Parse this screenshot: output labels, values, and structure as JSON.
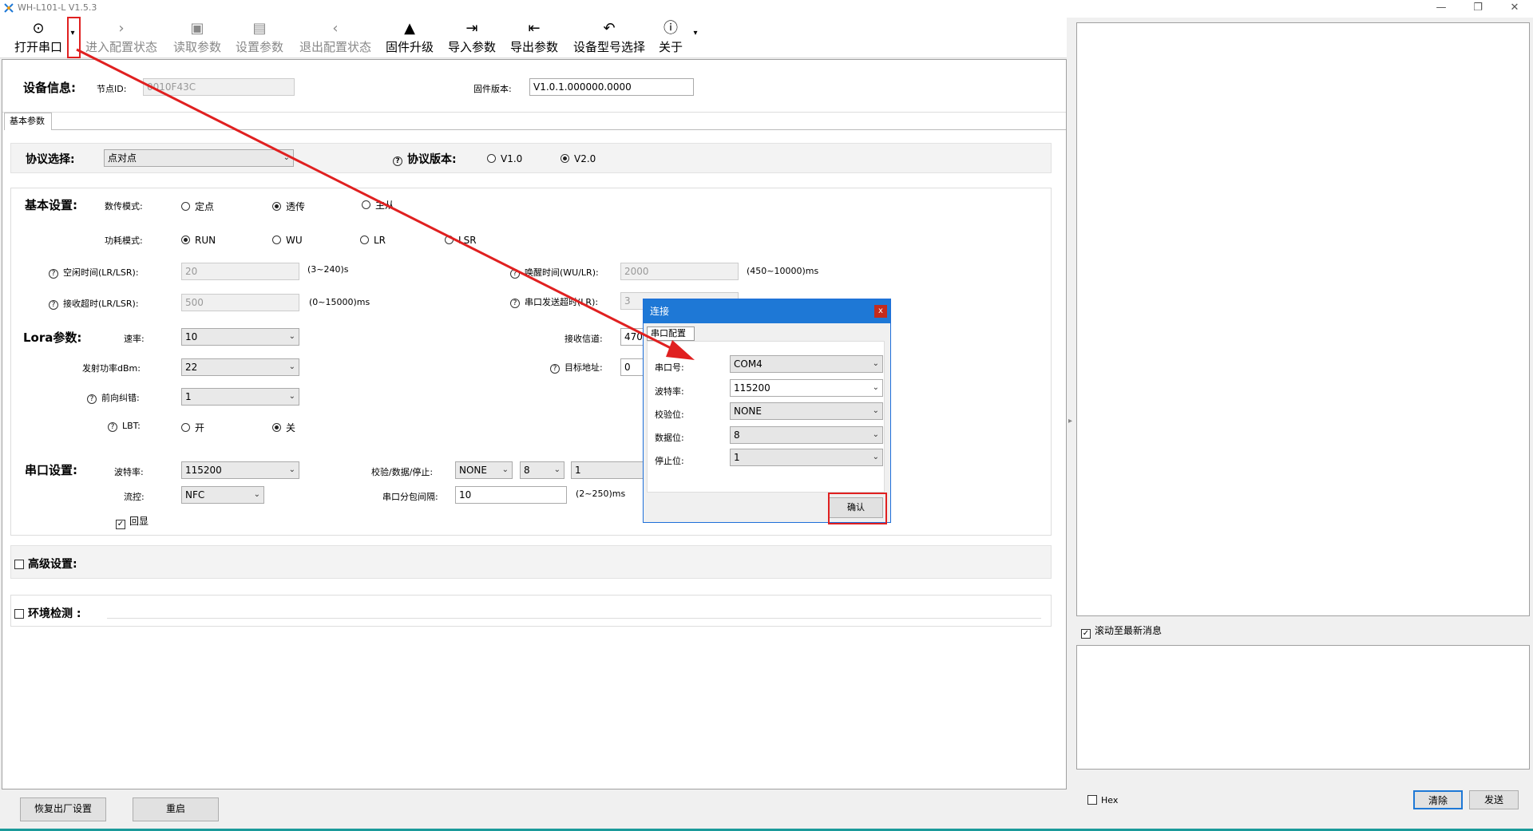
{
  "window": {
    "title": "WH-L101-L V1.5.3"
  },
  "toolbar": {
    "open_port": "打开串口",
    "enter_config": "进入配置状态",
    "read_params": "读取参数",
    "set_params": "设置参数",
    "exit_config": "退出配置状态",
    "firmware_upgrade": "固件升级",
    "import_params": "导入参数",
    "export_params": "导出参数",
    "device_model": "设备型号选择",
    "about": "关于"
  },
  "device_info": {
    "heading": "设备信息:",
    "node_id_label": "节点ID:",
    "node_id_value": "0010F43C",
    "firmware_label": "固件版本:",
    "firmware_value": "V1.0.1.000000.0000"
  },
  "tabs": {
    "basic": "基本参数"
  },
  "protocol": {
    "label": "协议选择:",
    "value": "点对点",
    "version_label": "协议版本:",
    "v1": "V1.0",
    "v2": "V2.0"
  },
  "basic": {
    "heading": "基本设置:",
    "transfer_mode_label": "数传模式:",
    "mode_fixed": "定点",
    "mode_transparent": "透传",
    "mode_third": "主从",
    "power_mode_label": "功耗模式:",
    "power_run": "RUN",
    "power_wu": "WU",
    "power_lr": "LR",
    "power_lsr": "LSR",
    "idle_label": "空闲时间(LR/LSR):",
    "idle_value": "20",
    "idle_range": "(3~240)s",
    "wake_label": "唤醒时间(WU/LR):",
    "wake_value": "2000",
    "wake_range": "(450~10000)ms",
    "recv_timeout_label": "接收超时(LR/LSR):",
    "recv_timeout_value": "500",
    "recv_timeout_range": "(0~15000)ms",
    "uart_timeout_label": "串口发送超时(LR):",
    "uart_timeout_value": "3"
  },
  "lora": {
    "heading": "Lora参数:",
    "rate_label": "速率:",
    "rate_value": "10",
    "power_label": "发射功率dBm:",
    "power_value": "22",
    "fec_label": "前向纠错:",
    "fec_value": "1",
    "lbt_label": "LBT:",
    "lbt_on": "开",
    "lbt_off": "关",
    "channel_label": "接收信道:",
    "channel_value": "4700",
    "target_label": "目标地址:",
    "target_value": "0"
  },
  "serial": {
    "heading": "串口设置:",
    "baud_label": "波特率:",
    "baud_value": "115200",
    "check_label": "校验/数据/停止:",
    "parity_value": "NONE",
    "data_value": "8",
    "stop_value": "1",
    "flow_label": "流控:",
    "flow_value": "NFC",
    "interval_label": "串口分包间隔:",
    "interval_value": "10",
    "interval_range": "(2~250)ms",
    "echo_label": "回显"
  },
  "advanced": {
    "label": "高级设置:"
  },
  "env": {
    "label": "环境检测 :"
  },
  "bottom": {
    "factory_reset": "恢复出厂设置",
    "restart": "重启"
  },
  "right": {
    "scroll_latest": "滚动至最新消息",
    "hex": "Hex",
    "clear": "清除",
    "send": "发送"
  },
  "dialog": {
    "title": "连接",
    "close": "x",
    "tab": "串口配置",
    "port_label": "串口号:",
    "port_value": "COM4",
    "baud_label": "波特率:",
    "baud_value": "115200",
    "parity_label": "校验位:",
    "parity_value": "NONE",
    "data_label": "数据位:",
    "data_value": "8",
    "stop_label": "停止位:",
    "stop_value": "1",
    "confirm": "确认"
  },
  "colors": {
    "accent": "#1e78d6",
    "annotation": "#e02020"
  }
}
